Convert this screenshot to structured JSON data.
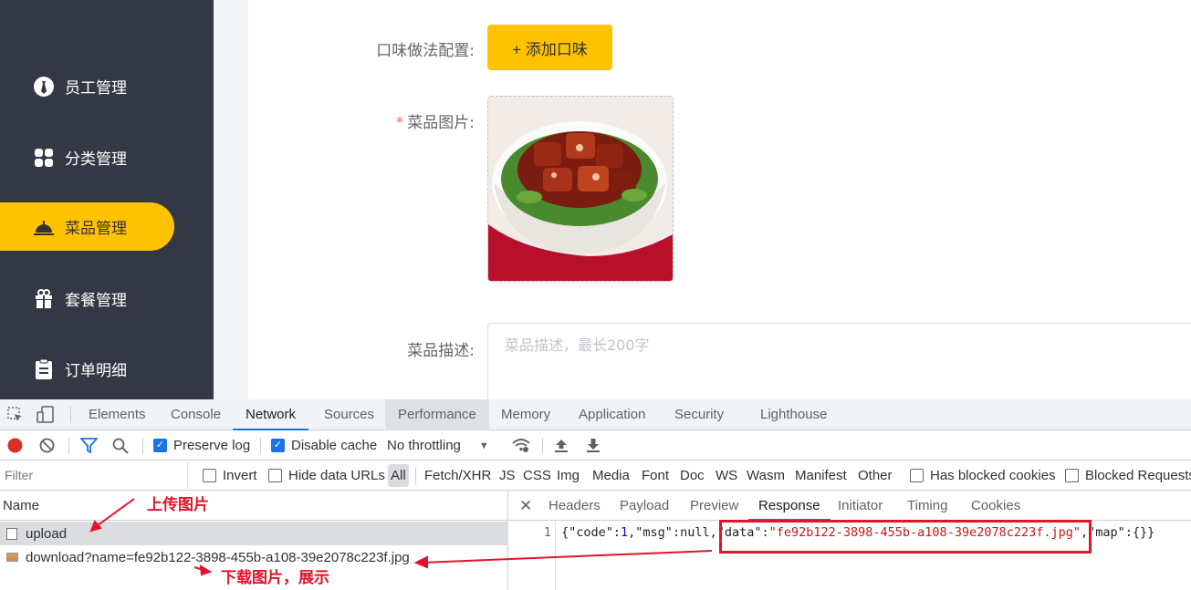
{
  "sidebar": {
    "items": [
      {
        "label": "员工管理",
        "icon": "employee-icon",
        "active": false
      },
      {
        "label": "分类管理",
        "icon": "category-icon",
        "active": false
      },
      {
        "label": "菜品管理",
        "icon": "dish-icon",
        "active": true
      },
      {
        "label": "套餐管理",
        "icon": "gift-icon",
        "active": false
      },
      {
        "label": "订单明细",
        "icon": "clipboard-icon",
        "active": false
      }
    ]
  },
  "form": {
    "flavor_label": "口味做法配置:",
    "add_flavor_button": "+ 添加口味",
    "image_label": "菜品图片:",
    "required_mark": "*",
    "desc_label": "菜品描述:",
    "desc_placeholder": "菜品描述，最长200字"
  },
  "devtools": {
    "tabs": [
      "Elements",
      "Console",
      "Network",
      "Sources",
      "Performance",
      "Memory",
      "Application",
      "Security",
      "Lighthouse"
    ],
    "active_tab": "Network",
    "toolbar": {
      "preserve_log": "Preserve log",
      "disable_cache": "Disable cache",
      "throttling": "No throttling"
    },
    "filter": {
      "placeholder": "Filter",
      "invert": "Invert",
      "hide_data_urls": "Hide data URLs",
      "types": [
        "All",
        "Fetch/XHR",
        "JS",
        "CSS",
        "Img",
        "Media",
        "Font",
        "Doc",
        "WS",
        "Wasm",
        "Manifest",
        "Other"
      ],
      "has_blocked_cookies": "Has blocked cookies",
      "blocked_requests": "Blocked Requests"
    },
    "name_header": "Name",
    "requests": [
      {
        "name": "upload"
      },
      {
        "name": "download?name=fe92b122-3898-455b-a108-39e2078c223f.jpg"
      }
    ],
    "detail_tabs": [
      "Headers",
      "Payload",
      "Preview",
      "Response",
      "Initiator",
      "Timing",
      "Cookies"
    ],
    "active_detail_tab": "Response",
    "response": {
      "line_no": "1",
      "p1": "{\"code\":",
      "code": "1",
      "p2": ",\"msg\":null,",
      "p3": "\"data\":",
      "data": "\"fe92b122-3898-455b-a108-39e2078c223f.jpg\"",
      "p4": ",\"map\":{}}"
    }
  },
  "annotations": {
    "upload": "上传图片",
    "download": "下载图片，展示"
  },
  "colors": {
    "sidebar_bg": "#343744",
    "accent": "#ffc200",
    "highlight_red": "#e0142b",
    "devtools_blue": "#1a73e8"
  }
}
